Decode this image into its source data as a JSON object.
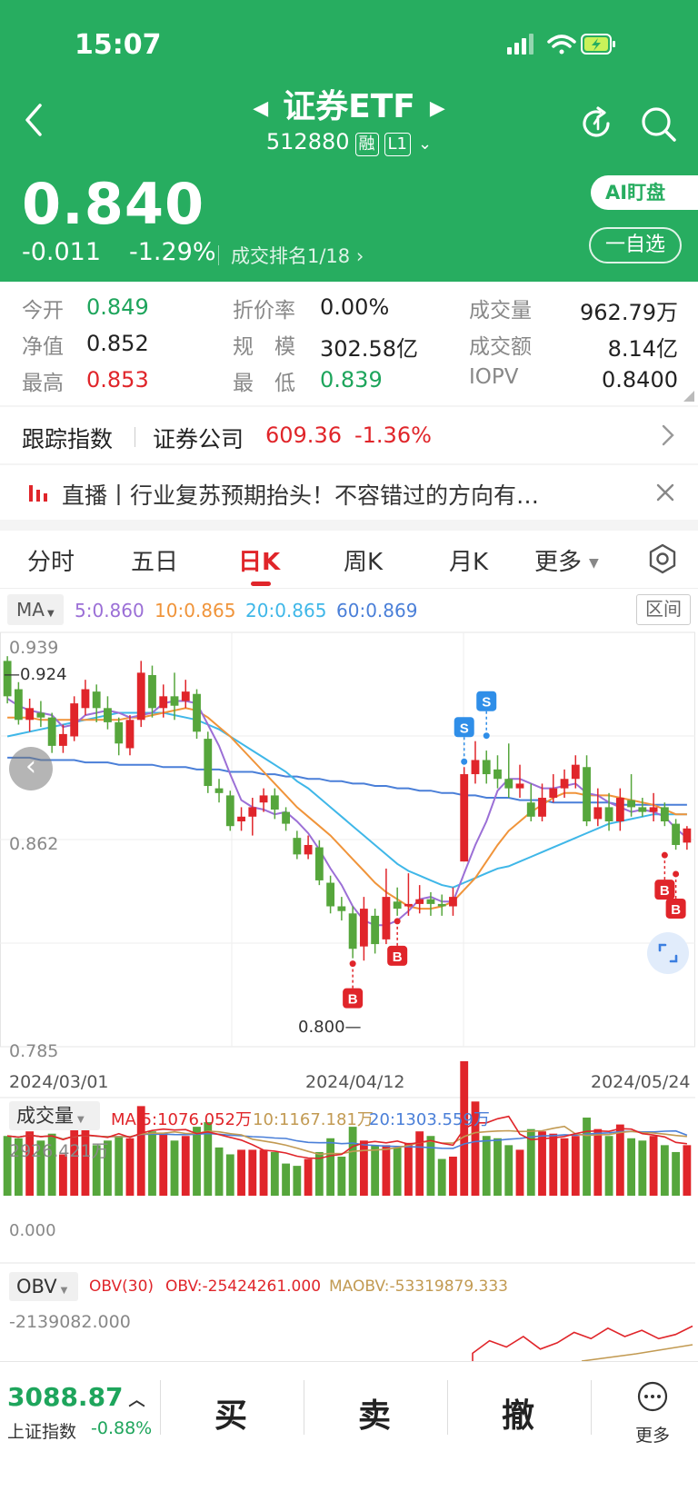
{
  "status_bar": {
    "time": "15:07"
  },
  "header": {
    "title": "证券ETF",
    "code": "512880",
    "tag_margin": "融",
    "tag_level": "L1",
    "price": "0.840",
    "change": "-0.011",
    "change_pct": "-1.29%",
    "rank": "成交排名1/18",
    "ai_button": "AI盯盘",
    "watch_button": "一自选"
  },
  "stats": [
    {
      "label": "今开",
      "value": "0.849",
      "color": "green"
    },
    {
      "label": "折价率",
      "value": "0.00%",
      "color": "normal"
    },
    {
      "label": "成交量",
      "value": "962.79万",
      "color": "normal"
    },
    {
      "label": "净值",
      "value": "0.852",
      "color": "normal"
    },
    {
      "label": "规　模",
      "value": "302.58亿",
      "color": "normal"
    },
    {
      "label": "成交额",
      "value": "8.14亿",
      "color": "normal"
    },
    {
      "label": "最高",
      "value": "0.853",
      "color": "red"
    },
    {
      "label": "最　低",
      "value": "0.839",
      "color": "green"
    },
    {
      "label": "IOPV",
      "value": "0.8400",
      "color": "normal"
    }
  ],
  "tracking": {
    "label": "跟踪指数",
    "index_name": "证券公司",
    "index_value": "609.36",
    "index_change": "-1.36%"
  },
  "live_banner": {
    "text": "直播丨行业复苏预期抬头！不容错过的方向有…"
  },
  "tabs": [
    "分时",
    "五日",
    "日K",
    "周K",
    "月K",
    "更多"
  ],
  "active_tab": "日K",
  "ma_legend": {
    "selector": "MA",
    "ma5": "5:0.860",
    "ma10": "10:0.865",
    "ma20": "20:0.865",
    "ma60": "60:0.869",
    "range_button": "区间"
  },
  "price_axis": {
    "top": "0.939",
    "mid": "0.862",
    "bottom": "0.785",
    "max_label": "0.924",
    "min_label": "0.800"
  },
  "date_axis": [
    "2024/03/01",
    "2024/04/12",
    "2024/05/24"
  ],
  "volume_legend": {
    "selector": "成交量",
    "ma5": "MA 5:1076.052万",
    "ma10": "10:1167.181万",
    "ma20": "20:1303.559万",
    "top": "2926.421万",
    "bottom": "0.000"
  },
  "obv_legend": {
    "selector": "OBV",
    "param": "OBV(30)",
    "obv": "OBV:-25424261.000",
    "maobv": "MAOBV:-53319879.333",
    "top": "-2139082.000"
  },
  "bottom_bar": {
    "index_value": "3088.87",
    "index_name": "上证指数",
    "index_change": "-0.88%",
    "buy": "买",
    "sell": "卖",
    "cancel": "撤",
    "more": "更多"
  },
  "signals": {
    "buy": "B",
    "sell": "S"
  },
  "colors": {
    "header_green": "#27ad60",
    "up_red": "#e0252a",
    "down_green": "#56a63c",
    "ma5": "#9b6fd6",
    "ma10": "#f0943a",
    "ma20": "#3fb7e8",
    "ma60": "#4a7fd8"
  },
  "chart_data": {
    "type": "candlestick",
    "x_range": [
      "2024/03/01",
      "2024/05/24"
    ],
    "ylim": [
      0.785,
      0.939
    ],
    "candles": [
      [
        0.93,
        0.915,
        0.932,
        0.912
      ],
      [
        0.918,
        0.905,
        0.921,
        0.903
      ],
      [
        0.905,
        0.91,
        0.914,
        0.9
      ],
      [
        0.908,
        0.906,
        0.913,
        0.902
      ],
      [
        0.906,
        0.894,
        0.908,
        0.891
      ],
      [
        0.894,
        0.899,
        0.903,
        0.891
      ],
      [
        0.898,
        0.912,
        0.915,
        0.896
      ],
      [
        0.91,
        0.918,
        0.922,
        0.907
      ],
      [
        0.917,
        0.91,
        0.92,
        0.904
      ],
      [
        0.91,
        0.904,
        0.915,
        0.901
      ],
      [
        0.904,
        0.895,
        0.906,
        0.89
      ],
      [
        0.893,
        0.905,
        0.907,
        0.89
      ],
      [
        0.905,
        0.925,
        0.93,
        0.902
      ],
      [
        0.924,
        0.91,
        0.928,
        0.906
      ],
      [
        0.91,
        0.915,
        0.92,
        0.906
      ],
      [
        0.915,
        0.911,
        0.925,
        0.905
      ],
      [
        0.913,
        0.917,
        0.922,
        0.91
      ],
      [
        0.916,
        0.9,
        0.918,
        0.897
      ],
      [
        0.897,
        0.877,
        0.9,
        0.874
      ],
      [
        0.876,
        0.874,
        0.88,
        0.87
      ],
      [
        0.873,
        0.86,
        0.875,
        0.858
      ],
      [
        0.862,
        0.864,
        0.868,
        0.858
      ],
      [
        0.864,
        0.868,
        0.872,
        0.856
      ],
      [
        0.87,
        0.873,
        0.876,
        0.866
      ],
      [
        0.873,
        0.867,
        0.876,
        0.863
      ],
      [
        0.866,
        0.861,
        0.868,
        0.858
      ],
      [
        0.855,
        0.848,
        0.858,
        0.846
      ],
      [
        0.848,
        0.852,
        0.856,
        0.846
      ],
      [
        0.851,
        0.837,
        0.854,
        0.835
      ],
      [
        0.836,
        0.826,
        0.839,
        0.823
      ],
      [
        0.826,
        0.824,
        0.83,
        0.82
      ],
      [
        0.823,
        0.808,
        0.826,
        0.804
      ],
      [
        0.809,
        0.825,
        0.83,
        0.803
      ],
      [
        0.822,
        0.81,
        0.825,
        0.806
      ],
      [
        0.812,
        0.83,
        0.842,
        0.81
      ],
      [
        0.828,
        0.825,
        0.834,
        0.822
      ],
      [
        0.826,
        0.827,
        0.84,
        0.822
      ],
      [
        0.827,
        0.829,
        0.835,
        0.823
      ],
      [
        0.829,
        0.827,
        0.832,
        0.822
      ],
      [
        0.827,
        0.826,
        0.831,
        0.822
      ],
      [
        0.826,
        0.83,
        0.834,
        0.822
      ],
      [
        0.845,
        0.882,
        0.885,
        0.845
      ],
      [
        0.882,
        0.888,
        0.896,
        0.878
      ],
      [
        0.888,
        0.882,
        0.892,
        0.878
      ],
      [
        0.884,
        0.88,
        0.89,
        0.876
      ],
      [
        0.88,
        0.876,
        0.895,
        0.872
      ],
      [
        0.876,
        0.878,
        0.886,
        0.872
      ],
      [
        0.87,
        0.864,
        0.878,
        0.862
      ],
      [
        0.864,
        0.872,
        0.878,
        0.862
      ],
      [
        0.872,
        0.876,
        0.882,
        0.87
      ],
      [
        0.876,
        0.88,
        0.884,
        0.872
      ],
      [
        0.88,
        0.886,
        0.89,
        0.876
      ],
      [
        0.885,
        0.862,
        0.89,
        0.86
      ],
      [
        0.863,
        0.868,
        0.876,
        0.86
      ],
      [
        0.868,
        0.862,
        0.874,
        0.858
      ],
      [
        0.862,
        0.872,
        0.876,
        0.858
      ],
      [
        0.871,
        0.868,
        0.882,
        0.864
      ],
      [
        0.868,
        0.866,
        0.872,
        0.864
      ],
      [
        0.866,
        0.868,
        0.874,
        0.862
      ],
      [
        0.868,
        0.862,
        0.87,
        0.86
      ],
      [
        0.861,
        0.852,
        0.863,
        0.85
      ],
      [
        0.853,
        0.859,
        0.86,
        0.85
      ]
    ],
    "ma5": [
      0.914,
      0.911,
      0.909,
      0.908,
      0.907,
      0.902,
      0.903,
      0.907,
      0.908,
      0.909,
      0.908,
      0.906,
      0.907,
      0.908,
      0.912,
      0.913,
      0.913,
      0.912,
      0.903,
      0.894,
      0.882,
      0.871,
      0.868,
      0.867,
      0.865,
      0.866,
      0.862,
      0.857,
      0.85,
      0.842,
      0.835,
      0.826,
      0.82,
      0.818,
      0.818,
      0.82,
      0.824,
      0.829,
      0.83,
      0.828,
      0.828,
      0.84,
      0.852,
      0.862,
      0.875,
      0.88,
      0.88,
      0.878,
      0.876,
      0.876,
      0.877,
      0.878,
      0.874,
      0.873,
      0.87,
      0.868,
      0.866,
      0.867,
      0.866,
      0.864,
      0.859,
      0.855
    ],
    "ma10": [
      0.906,
      0.906,
      0.906,
      0.905,
      0.905,
      0.905,
      0.905,
      0.905,
      0.905,
      0.905,
      0.905,
      0.906,
      0.906,
      0.907,
      0.908,
      0.909,
      0.91,
      0.909,
      0.906,
      0.902,
      0.898,
      0.893,
      0.888,
      0.883,
      0.878,
      0.873,
      0.868,
      0.864,
      0.86,
      0.856,
      0.851,
      0.846,
      0.841,
      0.836,
      0.832,
      0.829,
      0.826,
      0.825,
      0.825,
      0.826,
      0.828,
      0.833,
      0.838,
      0.845,
      0.852,
      0.858,
      0.862,
      0.866,
      0.869,
      0.872,
      0.874,
      0.874,
      0.873,
      0.873,
      0.873,
      0.872,
      0.871,
      0.87,
      0.869,
      0.867,
      0.865,
      0.865
    ],
    "ma20": [
      0.898,
      0.899,
      0.9,
      0.901,
      0.902,
      0.903,
      0.904,
      0.905,
      0.906,
      0.907,
      0.908,
      0.908,
      0.908,
      0.908,
      0.908,
      0.907,
      0.906,
      0.905,
      0.903,
      0.901,
      0.898,
      0.895,
      0.892,
      0.889,
      0.886,
      0.883,
      0.879,
      0.876,
      0.872,
      0.868,
      0.864,
      0.86,
      0.856,
      0.852,
      0.848,
      0.844,
      0.841,
      0.839,
      0.837,
      0.835,
      0.834,
      0.836,
      0.838,
      0.84,
      0.842,
      0.843,
      0.845,
      0.847,
      0.849,
      0.851,
      0.853,
      0.855,
      0.857,
      0.859,
      0.861,
      0.862,
      0.863,
      0.864,
      0.865,
      0.865,
      0.865,
      0.865
    ],
    "ma60": [
      0.889,
      0.889,
      0.889,
      0.888,
      0.888,
      0.888,
      0.888,
      0.887,
      0.887,
      0.887,
      0.886,
      0.886,
      0.886,
      0.886,
      0.885,
      0.885,
      0.885,
      0.884,
      0.884,
      0.884,
      0.883,
      0.883,
      0.883,
      0.882,
      0.882,
      0.881,
      0.881,
      0.88,
      0.88,
      0.879,
      0.879,
      0.878,
      0.878,
      0.877,
      0.877,
      0.876,
      0.876,
      0.875,
      0.875,
      0.874,
      0.874,
      0.873,
      0.873,
      0.872,
      0.872,
      0.872,
      0.871,
      0.871,
      0.871,
      0.87,
      0.87,
      0.87,
      0.87,
      0.87,
      0.87,
      0.869,
      0.869,
      0.869,
      0.869,
      0.869,
      0.869,
      0.869
    ],
    "volume": [
      1300,
      1250,
      1400,
      1200,
      1350,
      900,
      1650,
      1500,
      1100,
      1200,
      1300,
      1250,
      1950,
      1400,
      1350,
      1200,
      1300,
      1500,
      1600,
      1050,
      900,
      1000,
      1000,
      1000,
      950,
      700,
      650,
      800,
      950,
      1250,
      850,
      1500,
      1200,
      1100,
      1100,
      1050,
      1150,
      1400,
      1300,
      800,
      850,
      2926,
      2050,
      1300,
      1250,
      1100,
      1000,
      1450,
      1400,
      1350,
      1250,
      1300,
      1700,
      1450,
      1300,
      1550,
      1250,
      1200,
      1300,
      1100,
      950,
      1100
    ],
    "obv_line": [
      0.9,
      0.6,
      0.75,
      0.5,
      0.8,
      0.65,
      0.4,
      0.55,
      0.3,
      0.5,
      0.35,
      0.55,
      0.45,
      0.25
    ]
  }
}
